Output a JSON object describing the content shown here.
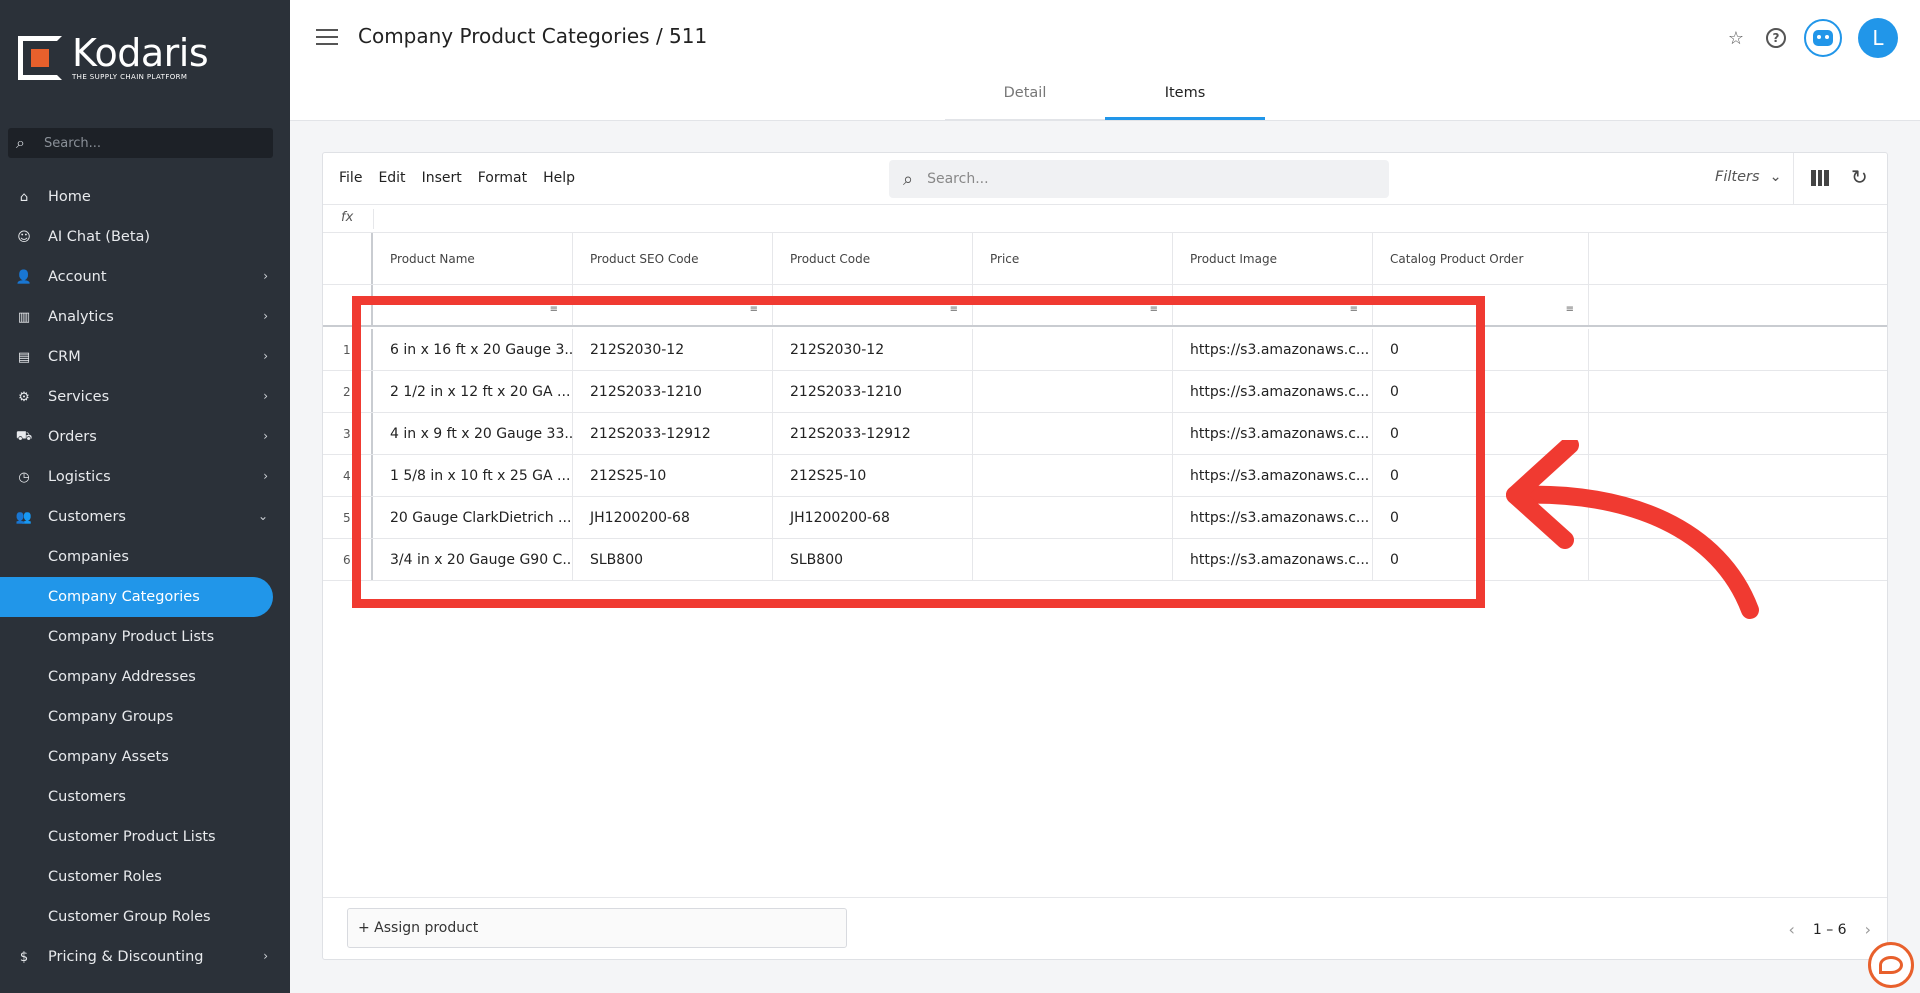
{
  "brand": {
    "name": "Kodaris",
    "tagline": "THE SUPPLY CHAIN PLATFORM",
    "accent": "#2196e9",
    "logo_orange": "#e8602c"
  },
  "sidebar": {
    "search_placeholder": "Search...",
    "items": [
      {
        "label": "Home",
        "icon": "home-icon",
        "glyph": "⌂",
        "chevron": ""
      },
      {
        "label": "AI Chat (Beta)",
        "icon": "robot-icon",
        "glyph": "☺",
        "chevron": ""
      },
      {
        "label": "Account",
        "icon": "user-icon",
        "glyph": "👤",
        "chevron": "›"
      },
      {
        "label": "Analytics",
        "icon": "analytics-icon",
        "glyph": "▥",
        "chevron": "›"
      },
      {
        "label": "CRM",
        "icon": "crm-icon",
        "glyph": "▤",
        "chevron": "›"
      },
      {
        "label": "Services",
        "icon": "services-icon",
        "glyph": "⚙",
        "chevron": "›"
      },
      {
        "label": "Orders",
        "icon": "truck-icon",
        "glyph": "⛟",
        "chevron": "›"
      },
      {
        "label": "Logistics",
        "icon": "logistics-icon",
        "glyph": "◷",
        "chevron": "›"
      },
      {
        "label": "Customers",
        "icon": "customers-icon",
        "glyph": "👥",
        "chevron": "⌄"
      }
    ],
    "sub_items": [
      {
        "label": "Companies",
        "active": false
      },
      {
        "label": "Company Categories",
        "active": true
      },
      {
        "label": "Company Product Lists",
        "active": false
      },
      {
        "label": "Company Addresses",
        "active": false
      },
      {
        "label": "Company Groups",
        "active": false
      },
      {
        "label": "Company Assets",
        "active": false
      },
      {
        "label": "Customers",
        "active": false
      },
      {
        "label": "Customer Product Lists",
        "active": false
      },
      {
        "label": "Customer Roles",
        "active": false
      },
      {
        "label": "Customer Group Roles",
        "active": false
      }
    ],
    "bottom_item": {
      "label": "Pricing & Discounting",
      "glyph": "$",
      "chevron": "›"
    }
  },
  "header": {
    "title": "Company Product Categories / 511",
    "avatar_initial": "L",
    "tabs": [
      {
        "label": "Detail",
        "active": false
      },
      {
        "label": "Items",
        "active": true
      }
    ]
  },
  "grid": {
    "menus": [
      "File",
      "Edit",
      "Insert",
      "Format",
      "Help"
    ],
    "search_placeholder": "Search...",
    "filters_label": "Filters",
    "fx_label": "fx",
    "columns": [
      "Product Name",
      "Product SEO Code",
      "Product Code",
      "Price",
      "Product Image",
      "Catalog Product Order"
    ],
    "rows": [
      {
        "num": "1",
        "cells": [
          "6 in x 16 ft x 20 Gauge 3...",
          "212S2030-12",
          "212S2030-12",
          "",
          "https://s3.amazonaws.c...",
          "0"
        ]
      },
      {
        "num": "2",
        "cells": [
          "2 1/2 in x 12 ft x 20 GA ...",
          "212S2033-1210",
          "212S2033-1210",
          "",
          "https://s3.amazonaws.c...",
          "0"
        ]
      },
      {
        "num": "3",
        "cells": [
          "4 in x 9 ft x 20 Gauge 33...",
          "212S2033-12912",
          "212S2033-12912",
          "",
          "https://s3.amazonaws.c...",
          "0"
        ]
      },
      {
        "num": "4",
        "cells": [
          "1 5/8 in x 10 ft x 25 GA ...",
          "212S25-10",
          "212S25-10",
          "",
          "https://s3.amazonaws.c...",
          "0"
        ]
      },
      {
        "num": "5",
        "cells": [
          "20 Gauge ClarkDietrich ...",
          "JH1200200-68",
          "JH1200200-68",
          "",
          "https://s3.amazonaws.c...",
          "0"
        ]
      },
      {
        "num": "6",
        "cells": [
          "3/4 in x 20 Gauge G90 C...",
          "SLB800",
          "SLB800",
          "",
          "https://s3.amazonaws.c...",
          "0"
        ]
      }
    ],
    "assign_label": "+ Assign product",
    "pager_range": "1 – 6"
  },
  "annotation": {
    "color": "#f03a31"
  }
}
